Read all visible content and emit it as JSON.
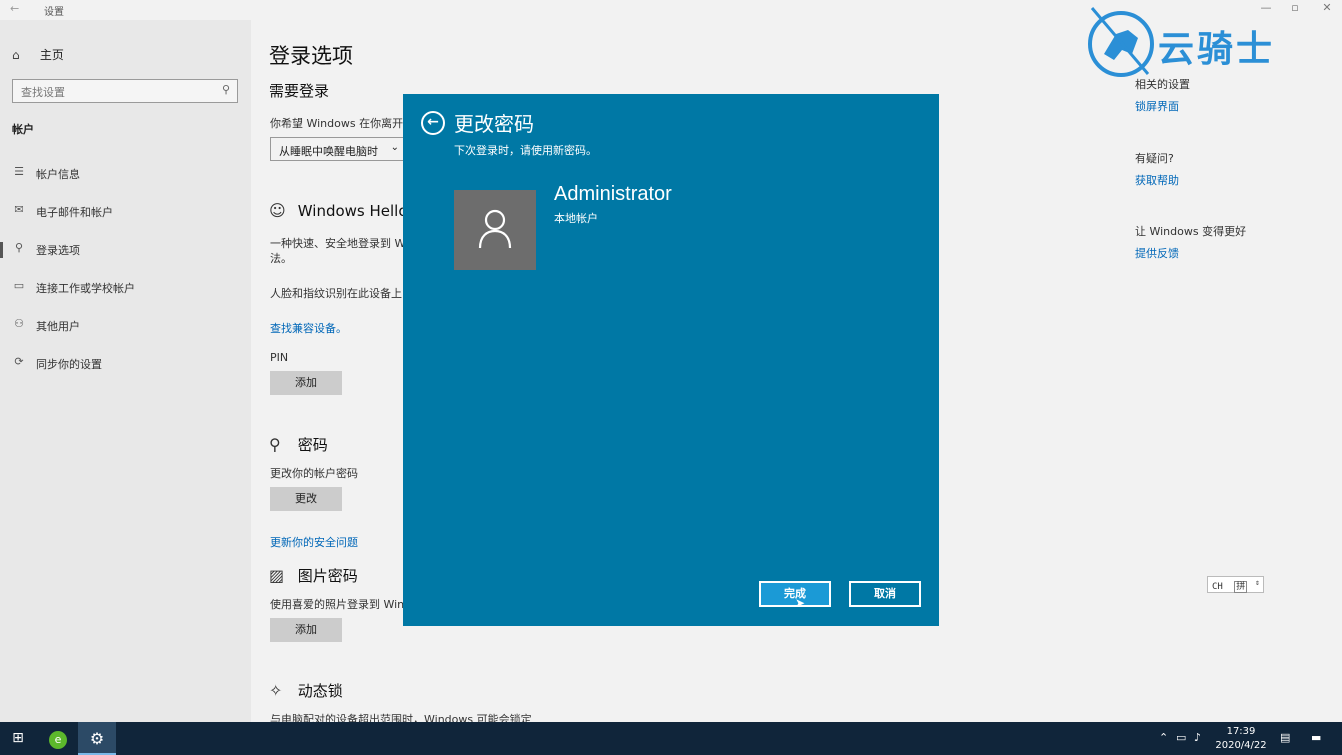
{
  "window": {
    "title": "设置",
    "controls": [
      "—",
      "▫",
      "✕"
    ]
  },
  "sidebar": {
    "home": "主页",
    "search_placeholder": "查找设置",
    "section": "帐户",
    "items": [
      {
        "label": "帐户信息",
        "icon": "account-info-icon",
        "glyph": "☰"
      },
      {
        "label": "电子邮件和帐户",
        "icon": "mail-icon",
        "glyph": "✉"
      },
      {
        "label": "登录选项",
        "icon": "key-icon",
        "glyph": "⚲"
      },
      {
        "label": "连接工作或学校帐户",
        "icon": "briefcase-icon",
        "glyph": "▭"
      },
      {
        "label": "其他用户",
        "icon": "person-icon",
        "glyph": "⚇"
      },
      {
        "label": "同步你的设置",
        "icon": "sync-icon",
        "glyph": "⟳"
      }
    ]
  },
  "main": {
    "title": "登录选项",
    "require_signin": {
      "heading": "需要登录",
      "question": "你希望 Windows 在你离开电",
      "dropdown_value": "从睡眠中唤醒电脑时"
    },
    "hello": {
      "heading": "Windows Hello",
      "desc1": "一种快速、安全地登录到 W",
      "desc1b": "法。",
      "desc2": "人脸和指纹识别在此设备上",
      "link": "查找兼容设备。"
    },
    "pin": {
      "label": "PIN",
      "button": "添加"
    },
    "password": {
      "heading": "密码",
      "desc": "更改你的帐户密码",
      "button": "更改",
      "link": "更新你的安全问题"
    },
    "picture_password": {
      "heading": "图片密码",
      "desc": "使用喜爱的照片登录到 Win",
      "button": "添加"
    },
    "dynamic_lock": {
      "heading": "动态锁",
      "desc": "与电脑配对的设备超出范围时，Windows 可能会锁定"
    }
  },
  "right": {
    "related_label": "相关的设置",
    "related_link": "锁屏界面",
    "question_label": "有疑问?",
    "question_link": "获取帮助",
    "improve_label": "让 Windows 变得更好",
    "improve_link": "提供反馈"
  },
  "watermark": {
    "text": "云骑士"
  },
  "dialog": {
    "title": "更改密码",
    "subtitle": "下次登录时，请使用新密码。",
    "username": "Administrator",
    "account_type": "本地帐户",
    "finish_button": "完成",
    "cancel_button": "取消"
  },
  "ime": {
    "lang": "CH",
    "mode": "拼"
  },
  "taskbar": {
    "time": "17:39",
    "date": "2020/4/22"
  }
}
